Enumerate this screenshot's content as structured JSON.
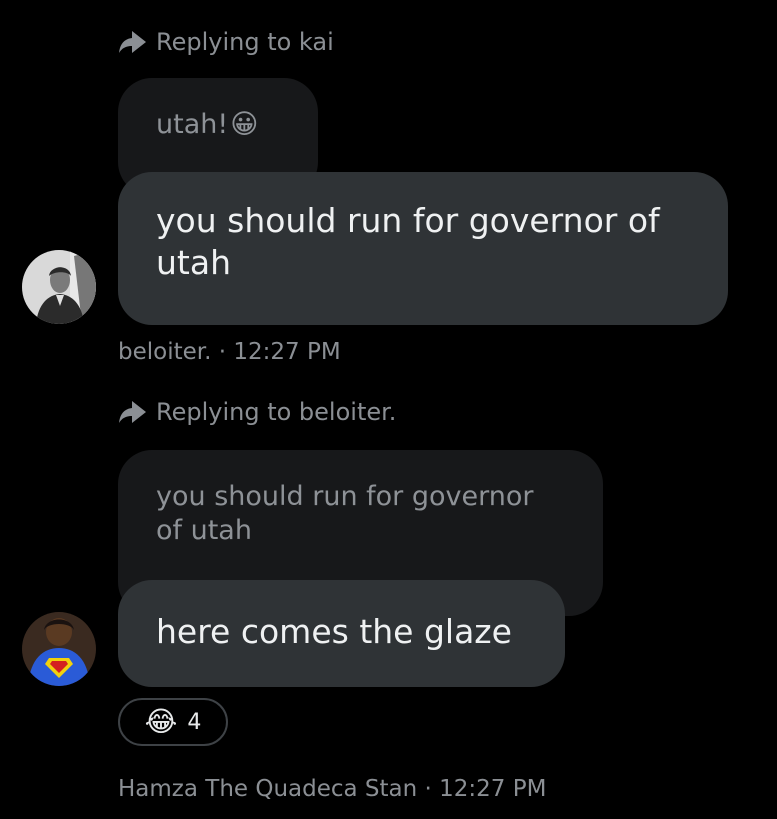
{
  "colors": {
    "background": "#000000",
    "bubble": "#2f3336",
    "quoted_bubble": "#17181a",
    "muted_text": "#8b8f94"
  },
  "messages": [
    {
      "reply_label": "Replying to kai",
      "quoted_text": "utah!",
      "quoted_emoji": "😀",
      "text": "you should run for governor of utah",
      "author": "beloiter.",
      "time": "12:27 PM",
      "meta": "beloiter. · 12:27 PM",
      "avatar_icon": "portrait-avatar-icon"
    },
    {
      "reply_label": "Replying to beloiter.",
      "quoted_text": "you should run for governor of utah",
      "text": "here comes the glaze",
      "reaction": {
        "emoji": "😂",
        "count": "4"
      },
      "author": "Hamza The Quadeca Stan",
      "time": "12:27 PM",
      "meta": "Hamza The Quadeca Stan · 12:27 PM",
      "avatar_icon": "superman-avatar-icon"
    }
  ]
}
